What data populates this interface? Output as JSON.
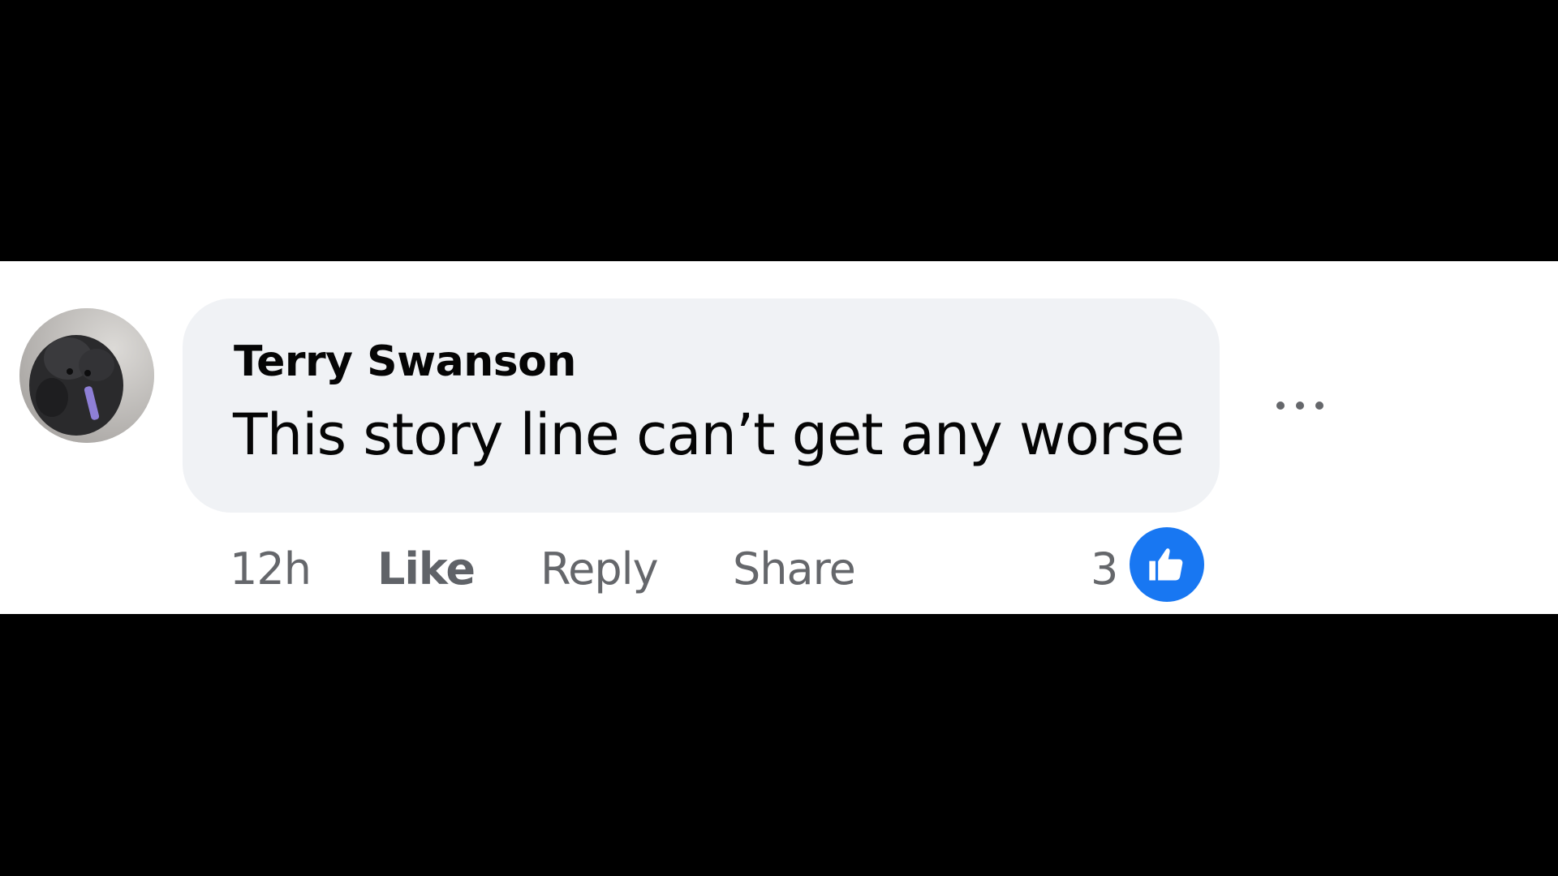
{
  "comment": {
    "author": "Terry Swanson",
    "text": "This story line can’t get any worse",
    "timestamp": "12h",
    "actions": {
      "like_label": "Like",
      "reply_label": "Reply",
      "share_label": "Share"
    },
    "reactions": {
      "count": "3",
      "type_icon": "thumbs-up-icon",
      "badge_color": "#1877f2"
    },
    "more_icon": "more-options-icon",
    "bubble_color": "#f0f2f5"
  }
}
